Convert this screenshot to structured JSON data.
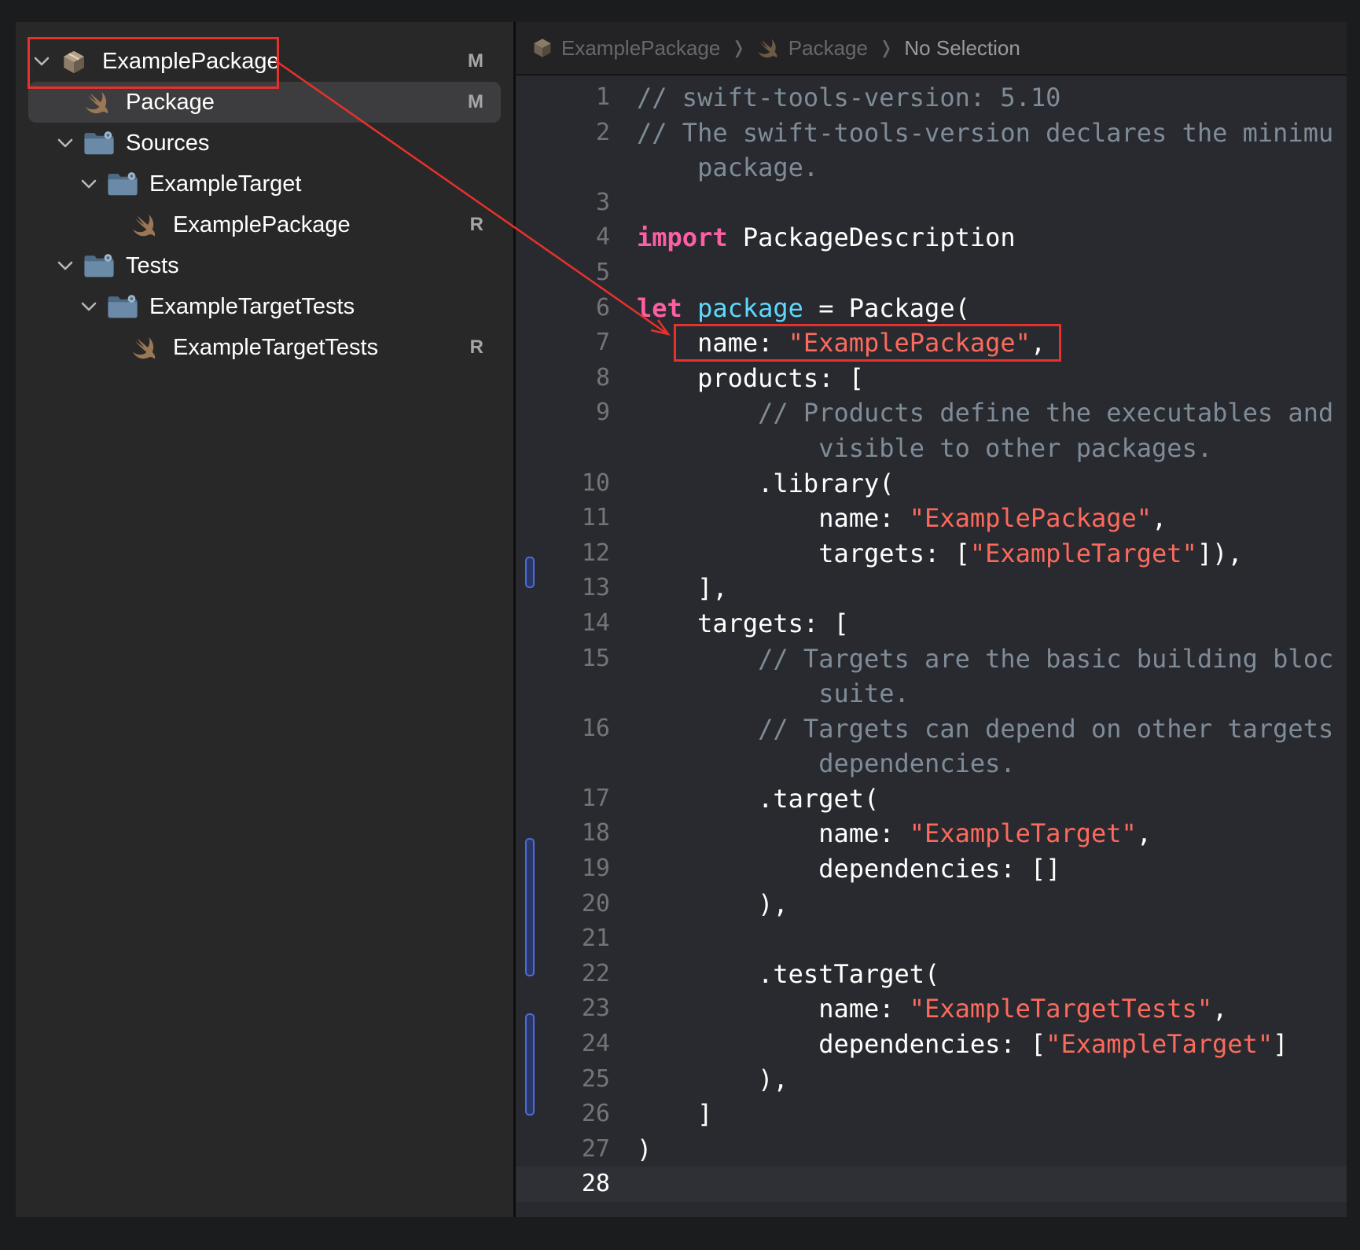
{
  "navigator": {
    "items": [
      {
        "label": "ExamplePackage",
        "badge": "M",
        "icon": "package-icon",
        "level": 0,
        "expanded": true
      },
      {
        "label": "Package",
        "badge": "M",
        "icon": "swift-file-icon",
        "level": 1,
        "selected": true
      },
      {
        "label": "Sources",
        "badge": "",
        "icon": "folder-icon",
        "level": 1,
        "expanded": true
      },
      {
        "label": "ExampleTarget",
        "badge": "",
        "icon": "folder-icon",
        "level": 2,
        "expanded": true
      },
      {
        "label": "ExamplePackage",
        "badge": "R",
        "icon": "swift-file-icon",
        "level": 3
      },
      {
        "label": "Tests",
        "badge": "",
        "icon": "folder-icon",
        "level": 1,
        "expanded": true
      },
      {
        "label": "ExampleTargetTests",
        "badge": "",
        "icon": "folder-icon",
        "level": 2,
        "expanded": true
      },
      {
        "label": "ExampleTargetTests",
        "badge": "R",
        "icon": "swift-file-icon",
        "level": 3
      }
    ]
  },
  "jumpbar": {
    "crumbs": [
      "ExamplePackage",
      "Package",
      "No Selection"
    ]
  },
  "editor": {
    "current_line": "28",
    "lines": [
      {
        "n": "1",
        "t": "// swift-tools-version: 5.10"
      },
      {
        "n": "2",
        "t": "// The swift-tools-version declares the minimu"
      },
      {
        "n": "",
        "t": "    package."
      },
      {
        "n": "3",
        "t": ""
      },
      {
        "n": "4",
        "t": "import PackageDescription"
      },
      {
        "n": "5",
        "t": ""
      },
      {
        "n": "6",
        "t": "let package = Package("
      },
      {
        "n": "7",
        "t": "    name: \"ExamplePackage\","
      },
      {
        "n": "8",
        "t": "    products: ["
      },
      {
        "n": "9",
        "t": "        // Products define the executables and"
      },
      {
        "n": "",
        "t": "            visible to other packages."
      },
      {
        "n": "10",
        "t": "        .library("
      },
      {
        "n": "11",
        "t": "            name: \"ExamplePackage\","
      },
      {
        "n": "12",
        "t": "            targets: [\"ExampleTarget\"]),"
      },
      {
        "n": "13",
        "t": "    ],"
      },
      {
        "n": "14",
        "t": "    targets: ["
      },
      {
        "n": "15",
        "t": "        // Targets are the basic building bloc"
      },
      {
        "n": "",
        "t": "            suite."
      },
      {
        "n": "16",
        "t": "        // Targets can depend on other targets"
      },
      {
        "n": "",
        "t": "            dependencies."
      },
      {
        "n": "17",
        "t": "        .target("
      },
      {
        "n": "18",
        "t": "            name: \"ExampleTarget\","
      },
      {
        "n": "19",
        "t": "            dependencies: []"
      },
      {
        "n": "20",
        "t": "        ),"
      },
      {
        "n": "21",
        "t": ""
      },
      {
        "n": "22",
        "t": "        .testTarget("
      },
      {
        "n": "23",
        "t": "            name: \"ExampleTargetTests\","
      },
      {
        "n": "24",
        "t": "            dependencies: [\"ExampleTarget\"]"
      },
      {
        "n": "25",
        "t": "        ),"
      },
      {
        "n": "26",
        "t": "    ]"
      },
      {
        "n": "27",
        "t": ")"
      },
      {
        "n": "28",
        "t": ""
      }
    ]
  },
  "colors": {
    "comment": "#7f8c98",
    "keyword": "#fc5fa3",
    "declaration": "#5dd8ff",
    "string": "#fc6a5d",
    "annotation": "#e8312c",
    "change_bar": "#4b6cd6"
  }
}
